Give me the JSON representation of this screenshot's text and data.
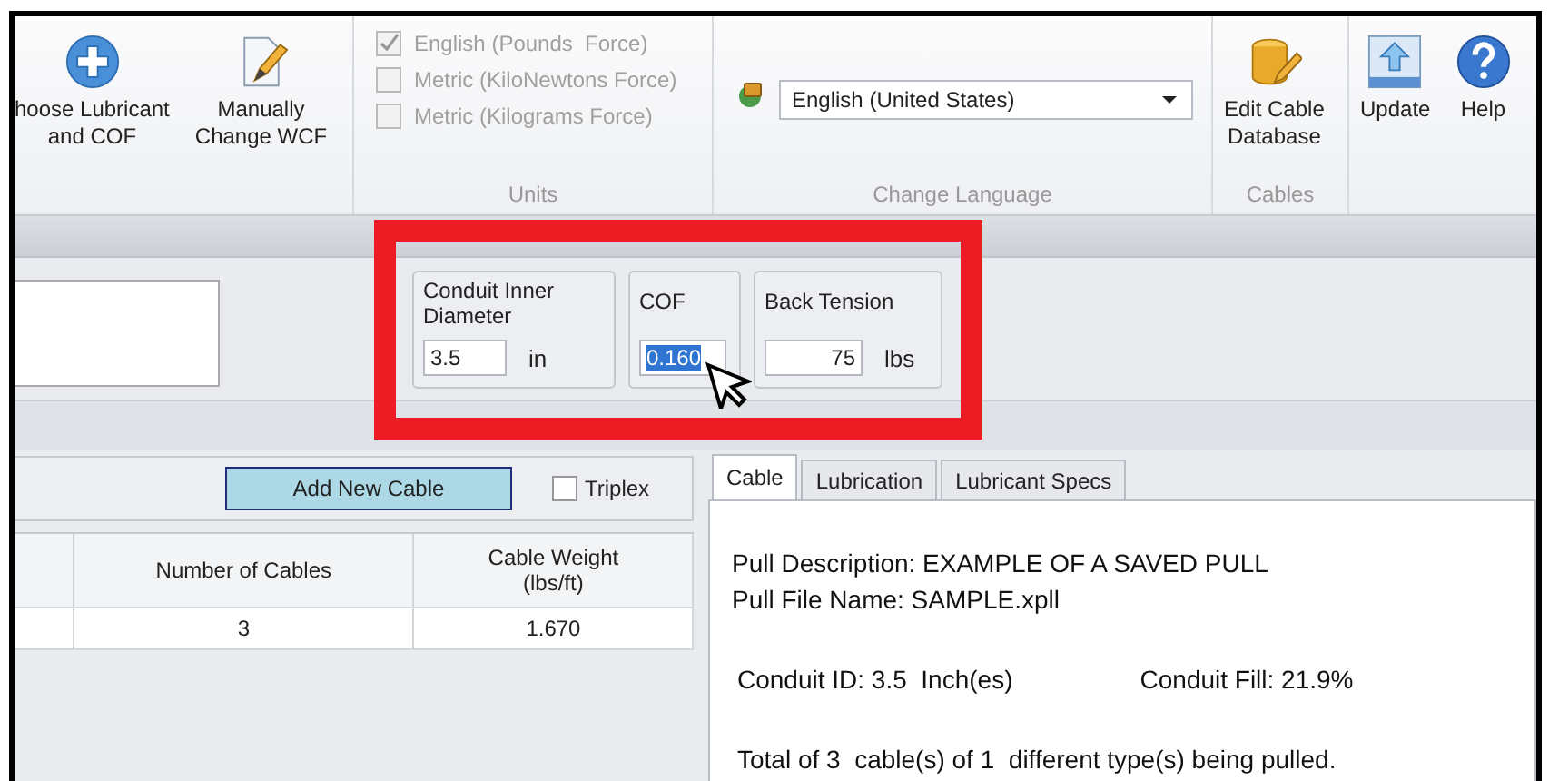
{
  "ribbon": {
    "buttons": [
      {
        "kind": "plus",
        "label": "hoose Lubricant\nand COF"
      },
      {
        "kind": "pencil",
        "label": "Manually\nChange WCF"
      }
    ],
    "units": {
      "label": "Units",
      "options": [
        {
          "label": "English (Pounds  Force)",
          "checked": true,
          "disabled": true
        },
        {
          "label": "Metric (KiloNewtons Force)",
          "checked": false,
          "disabled": true
        },
        {
          "label": "Metric (Kilograms Force)",
          "checked": false,
          "disabled": true
        }
      ]
    },
    "language": {
      "label": "Change Language",
      "value": "English (United States)"
    },
    "cables": {
      "label": "Cables",
      "button": "Edit Cable\nDatabase"
    },
    "tools": [
      {
        "kind": "update",
        "label": "Update"
      },
      {
        "kind": "help",
        "label": "Help"
      }
    ]
  },
  "parameters": [
    {
      "label": "Conduit Inner\nDiameter",
      "value": "3.5",
      "unit": "in",
      "selected": false
    },
    {
      "label": "COF",
      "value": "0.160",
      "selected": true
    },
    {
      "label": "Back Tension",
      "value": "75",
      "unit": "lbs",
      "selected": false
    }
  ],
  "cables_panel": {
    "add_button": "Add New Cable",
    "triplex": {
      "label": "Triplex",
      "checked": false
    },
    "columns": [
      "Number of Cables",
      "Cable Weight\n(lbs/ft)"
    ],
    "rows": [
      [
        "3",
        "1.670"
      ]
    ]
  },
  "info": {
    "tabs": [
      {
        "label": "Cable",
        "selected": true
      },
      {
        "label": "Lubrication",
        "selected": false
      },
      {
        "label": "Lubricant Specs",
        "selected": false
      }
    ],
    "lines": [
      "Pull Description: EXAMPLE OF A SAVED PULL",
      "Pull File Name: SAMPLE.xpll"
    ],
    "conduit_id": "Conduit ID: 3.5  Inch(es)",
    "conduit_fill": "Conduit Fill: 21.9%",
    "total": "Total of 3  cable(s) of 1  different type(s) being pulled."
  }
}
